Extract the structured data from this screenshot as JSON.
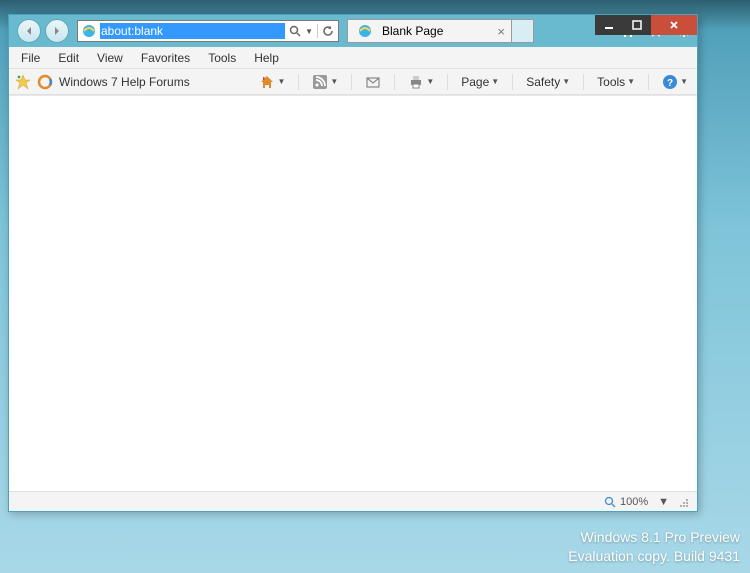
{
  "address_bar": {
    "url": "about:blank"
  },
  "tab": {
    "title": "Blank Page"
  },
  "menubar": {
    "file": "File",
    "edit": "Edit",
    "view": "View",
    "favorites": "Favorites",
    "tools": "Tools",
    "help": "Help"
  },
  "favorites_bar": {
    "bookmark1": "Windows 7 Help Forums"
  },
  "command_bar": {
    "page": "Page",
    "safety": "Safety",
    "tools": "Tools"
  },
  "status_bar": {
    "zoom": "100%"
  },
  "watermark": {
    "line1": "Windows 8.1 Pro Preview",
    "line2": "Evaluation copy. Build 9431"
  }
}
